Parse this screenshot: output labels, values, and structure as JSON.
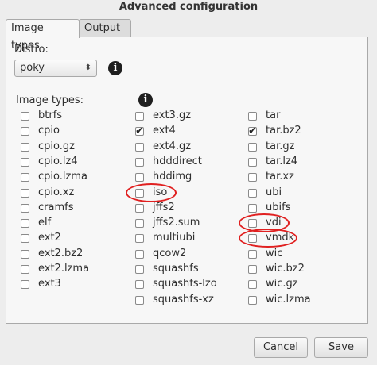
{
  "window": {
    "title": "Advanced configuration"
  },
  "tabs": [
    {
      "label": "Image types",
      "active": true
    },
    {
      "label": "Output",
      "active": false
    }
  ],
  "distro": {
    "label": "Distro:",
    "selected": "poky",
    "info_icon": "info-icon"
  },
  "image_types": {
    "label": "Image types:",
    "info_icon": "info-icon",
    "columns": [
      [
        {
          "name": "btrfs",
          "checked": false
        },
        {
          "name": "cpio",
          "checked": false
        },
        {
          "name": "cpio.gz",
          "checked": false
        },
        {
          "name": "cpio.lz4",
          "checked": false
        },
        {
          "name": "cpio.lzma",
          "checked": false
        },
        {
          "name": "cpio.xz",
          "checked": false
        },
        {
          "name": "cramfs",
          "checked": false
        },
        {
          "name": "elf",
          "checked": false
        },
        {
          "name": "ext2",
          "checked": false
        },
        {
          "name": "ext2.bz2",
          "checked": false
        },
        {
          "name": "ext2.lzma",
          "checked": false
        },
        {
          "name": "ext3",
          "checked": false
        }
      ],
      [
        {
          "name": "ext3.gz",
          "checked": false
        },
        {
          "name": "ext4",
          "checked": true
        },
        {
          "name": "ext4.gz",
          "checked": false
        },
        {
          "name": "hdddirect",
          "checked": false
        },
        {
          "name": "hddimg",
          "checked": false
        },
        {
          "name": "iso",
          "checked": false
        },
        {
          "name": "jffs2",
          "checked": false
        },
        {
          "name": "jffs2.sum",
          "checked": false
        },
        {
          "name": "multiubi",
          "checked": false
        },
        {
          "name": "qcow2",
          "checked": false
        },
        {
          "name": "squashfs",
          "checked": false
        },
        {
          "name": "squashfs-lzo",
          "checked": false
        },
        {
          "name": "squashfs-xz",
          "checked": false
        }
      ],
      [
        {
          "name": "tar",
          "checked": false
        },
        {
          "name": "tar.bz2",
          "checked": true
        },
        {
          "name": "tar.gz",
          "checked": false
        },
        {
          "name": "tar.lz4",
          "checked": false
        },
        {
          "name": "tar.xz",
          "checked": false
        },
        {
          "name": "ubi",
          "checked": false
        },
        {
          "name": "ubifs",
          "checked": false
        },
        {
          "name": "vdi",
          "checked": false
        },
        {
          "name": "vmdk",
          "checked": false
        },
        {
          "name": "wic",
          "checked": false
        },
        {
          "name": "wic.bz2",
          "checked": false
        },
        {
          "name": "wic.gz",
          "checked": false
        },
        {
          "name": "wic.lzma",
          "checked": false
        }
      ]
    ],
    "highlighted": [
      "iso",
      "vdi",
      "vmdk"
    ],
    "highlight_color": "#e02020"
  },
  "buttons": {
    "cancel": "Cancel",
    "save": "Save"
  }
}
